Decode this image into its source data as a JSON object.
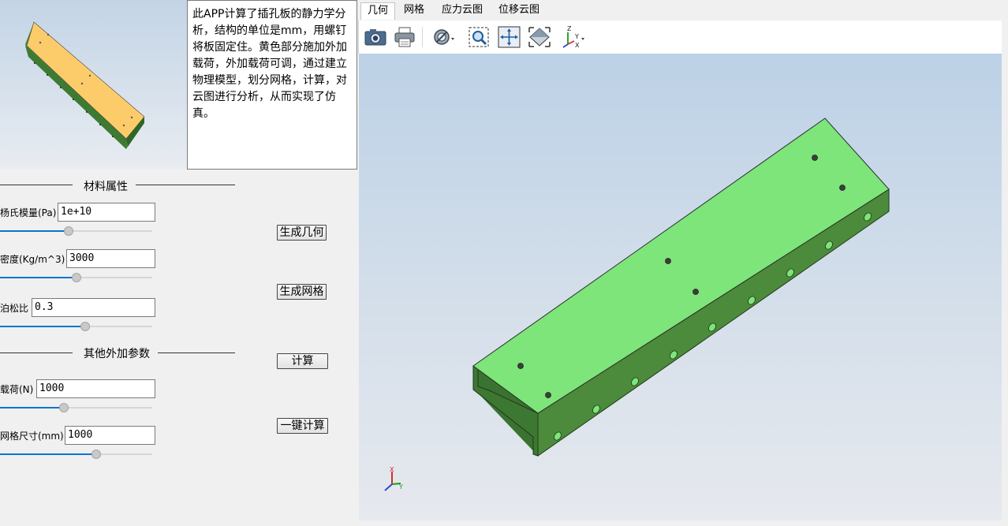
{
  "description": "此APP计算了插孔板的静力学分析，结构的单位是mm，用螺钉将板固定住。黄色部分施加外加载荷，外加载荷可调，通过建立物理模型，划分网格，计算，对云图进行分析，从而实现了仿真。",
  "material_section": {
    "title": "材料属性",
    "youngs_modulus": {
      "label": "杨氏模量(Pa)",
      "value": "1e+10",
      "slider_fraction": 0.45
    },
    "density": {
      "label": "密度(Kg/m^3)",
      "value": "3000",
      "slider_fraction": 0.5
    },
    "poisson": {
      "label": "泊松比",
      "value": "0.3",
      "slider_fraction": 0.56
    }
  },
  "extra_section": {
    "title": "其他外加参数",
    "load": {
      "label": "载荷(N)",
      "value": "1000",
      "slider_fraction": 0.42
    },
    "mesh_size": {
      "label": "网格尺寸(mm)",
      "value": "1000",
      "slider_fraction": 0.63
    }
  },
  "buttons": {
    "generate_geometry": "生成几何",
    "generate_mesh": "生成网格",
    "compute": "计算",
    "one_click": "一键计算"
  },
  "tabs": [
    {
      "label": "几何",
      "active": true
    },
    {
      "label": "网格",
      "active": false
    },
    {
      "label": "应力云图",
      "active": false
    },
    {
      "label": "位移云图",
      "active": false
    }
  ],
  "toolbar_icons": [
    "camera-icon",
    "printer-icon",
    "visibility-icon",
    "zoom-box-icon",
    "zoom-extents-icon",
    "view-fit-icon",
    "axis-orientation-icon"
  ],
  "axes": {
    "x": "X",
    "y": "Y",
    "z": "Z"
  },
  "colors": {
    "model_top": "#7de57a",
    "model_side": "#3d7a36",
    "preview_top": "#fdcc6a",
    "slider_fill": "#0a74d2"
  }
}
